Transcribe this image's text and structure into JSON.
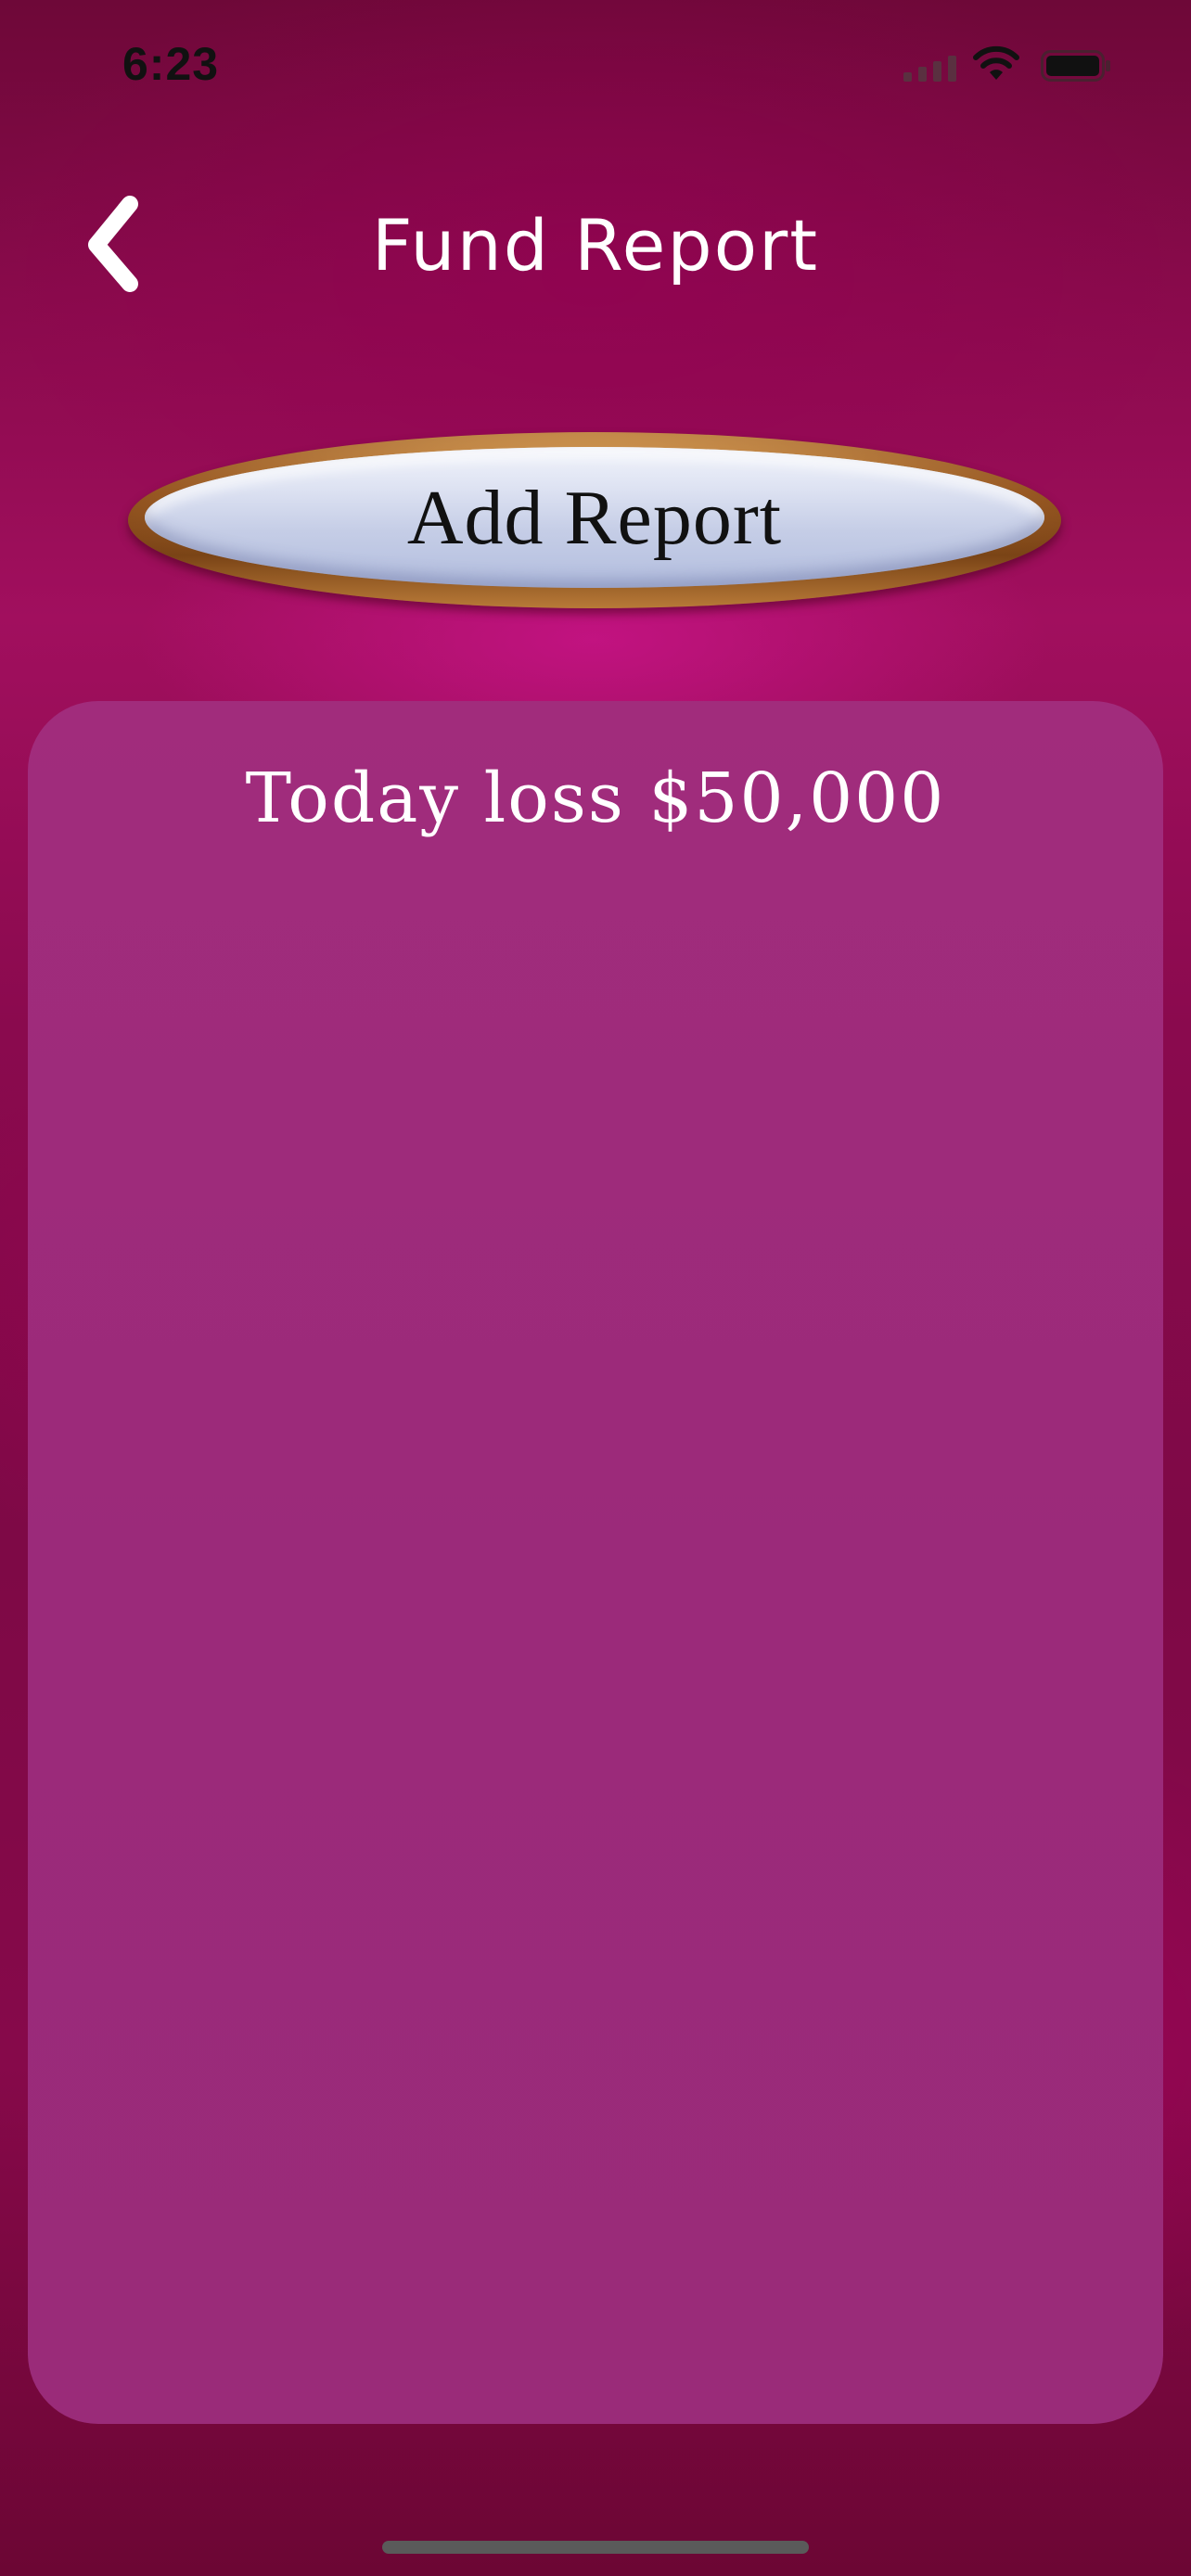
{
  "status_bar": {
    "time": "6:23"
  },
  "nav": {
    "back_icon": "chevron-left-icon",
    "title": "Fund Report"
  },
  "actions": {
    "add_report_label": "Add Report"
  },
  "reports": {
    "entries": [
      "Today loss $50,000"
    ]
  },
  "colors": {
    "background": "#8a0a4c",
    "panel": "#9b2a7a",
    "title_text": "#ffffff",
    "button_text": "#111111"
  }
}
